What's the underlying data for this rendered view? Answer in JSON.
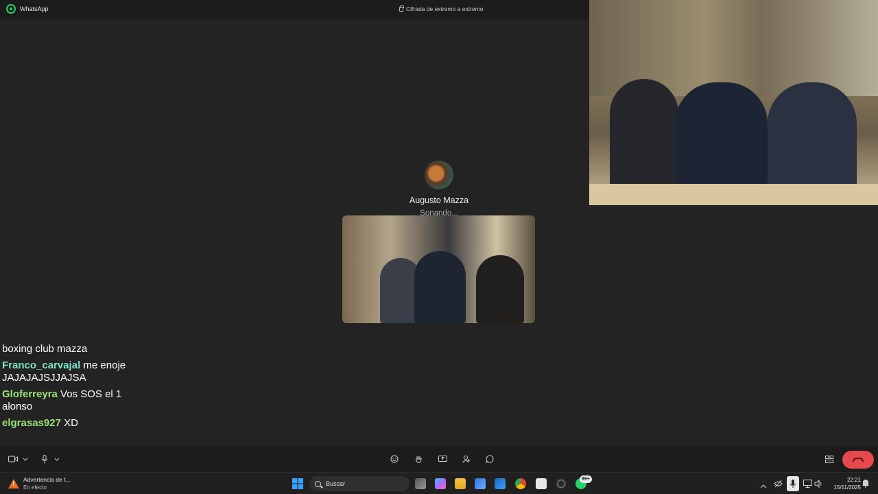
{
  "titlebar": {
    "app_name": "WhatsApp",
    "encryption_text": "Cifrada de extremo a extremo"
  },
  "call": {
    "contact_name": "Augusto Mazza",
    "status": "Sonando..."
  },
  "chat": {
    "partial_line": "boxing club mazza",
    "messages": [
      {
        "user": "Franco_carvajal",
        "user_color": "#7fe0c8",
        "text": "me enoje JAJAJAJSJJAJSA"
      },
      {
        "user": "Gloferreyra",
        "user_color": "#9be37a",
        "text": "Vos SOS el 1 alonso"
      },
      {
        "user": "elgrasas927",
        "user_color": "#9be37a",
        "text": "XD"
      }
    ]
  },
  "taskbar": {
    "notification_title": "Advertencia de t...",
    "notification_subtitle": "En efecto",
    "search_placeholder": "Buscar",
    "whatsapp_badge": "99+",
    "time": "22:21",
    "date": "15/11/2025"
  },
  "colors": {
    "accent": "#25d366",
    "hangup": "#e5484d"
  }
}
